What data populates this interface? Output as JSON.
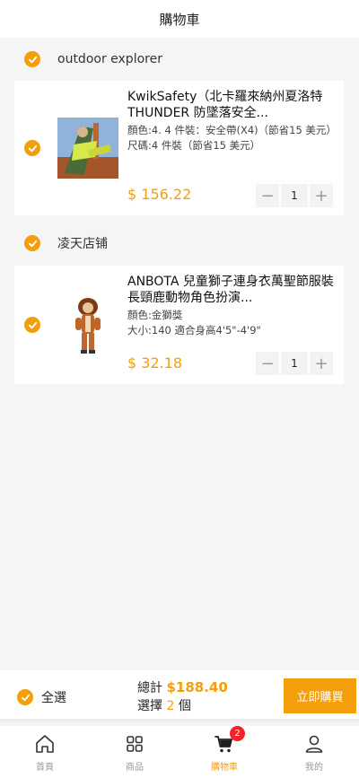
{
  "header": {
    "title": "購物車"
  },
  "stores": [
    {
      "name": "outdoor explorer",
      "item": {
        "title": "KwikSafety（北卡羅來納州夏洛特THUNDER 防墜落安全...",
        "attr1": "顏色:4. 4 件裝：安全帶(X4)（節省15 美元）",
        "attr2": "尺碼:4 件裝（節省15 美元）",
        "price": "$ 156.22",
        "qty": "1"
      }
    },
    {
      "name": "凌天店铺",
      "item": {
        "title": "ANBOTA 兒童獅子連身衣萬聖節服裝長頸鹿動物角色扮演...",
        "attr1": "顏色:金獅獎",
        "attr2": "大小:140 適合身高4'5\"-4'9\"",
        "price": "$ 32.18",
        "qty": "1"
      }
    }
  ],
  "footer": {
    "select_all": "全選",
    "total_label": "總計",
    "total_amount": "$188.40",
    "select_prefix": "選擇",
    "select_count": "2",
    "select_suffix": "個",
    "buy_label": "立即購買"
  },
  "tabs": [
    {
      "label": "首頁",
      "icon": "home-icon"
    },
    {
      "label": "商品",
      "icon": "grid-icon"
    },
    {
      "label": "購物車",
      "icon": "cart-icon",
      "badge": "2"
    },
    {
      "label": "我的",
      "icon": "user-icon"
    }
  ],
  "colors": {
    "accent": "#f59e0b",
    "badge": "#f5222d",
    "background": "#f5f5f5"
  }
}
